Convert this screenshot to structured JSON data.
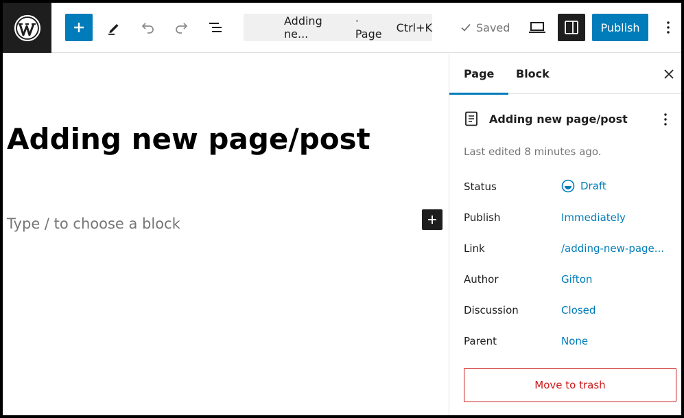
{
  "topbar": {
    "logo_icon": "wordpress-logo",
    "document_title": "Adding ne...",
    "document_type": "· Page",
    "shortcut": "Ctrl+K",
    "saved_label": "Saved",
    "publish_label": "Publish"
  },
  "editor": {
    "title": "Adding new page/post",
    "placeholder": "Type / to choose a block"
  },
  "sidebar": {
    "tabs": [
      {
        "label": "Page",
        "active": true
      },
      {
        "label": "Block",
        "active": false
      }
    ],
    "summary_title": "Adding new page/post",
    "last_edited": "Last edited 8 minutes ago.",
    "rows": [
      {
        "label": "Status",
        "value": "Draft"
      },
      {
        "label": "Publish",
        "value": "Immediately"
      },
      {
        "label": "Link",
        "value": "/adding-new-page..."
      },
      {
        "label": "Author",
        "value": "Gifton"
      },
      {
        "label": "Discussion",
        "value": "Closed"
      },
      {
        "label": "Parent",
        "value": "None"
      }
    ],
    "trash_label": "Move to trash"
  },
  "colors": {
    "accent": "#007cba",
    "dark": "#1e1e1e",
    "danger": "#cc1818",
    "muted": "#757575"
  }
}
